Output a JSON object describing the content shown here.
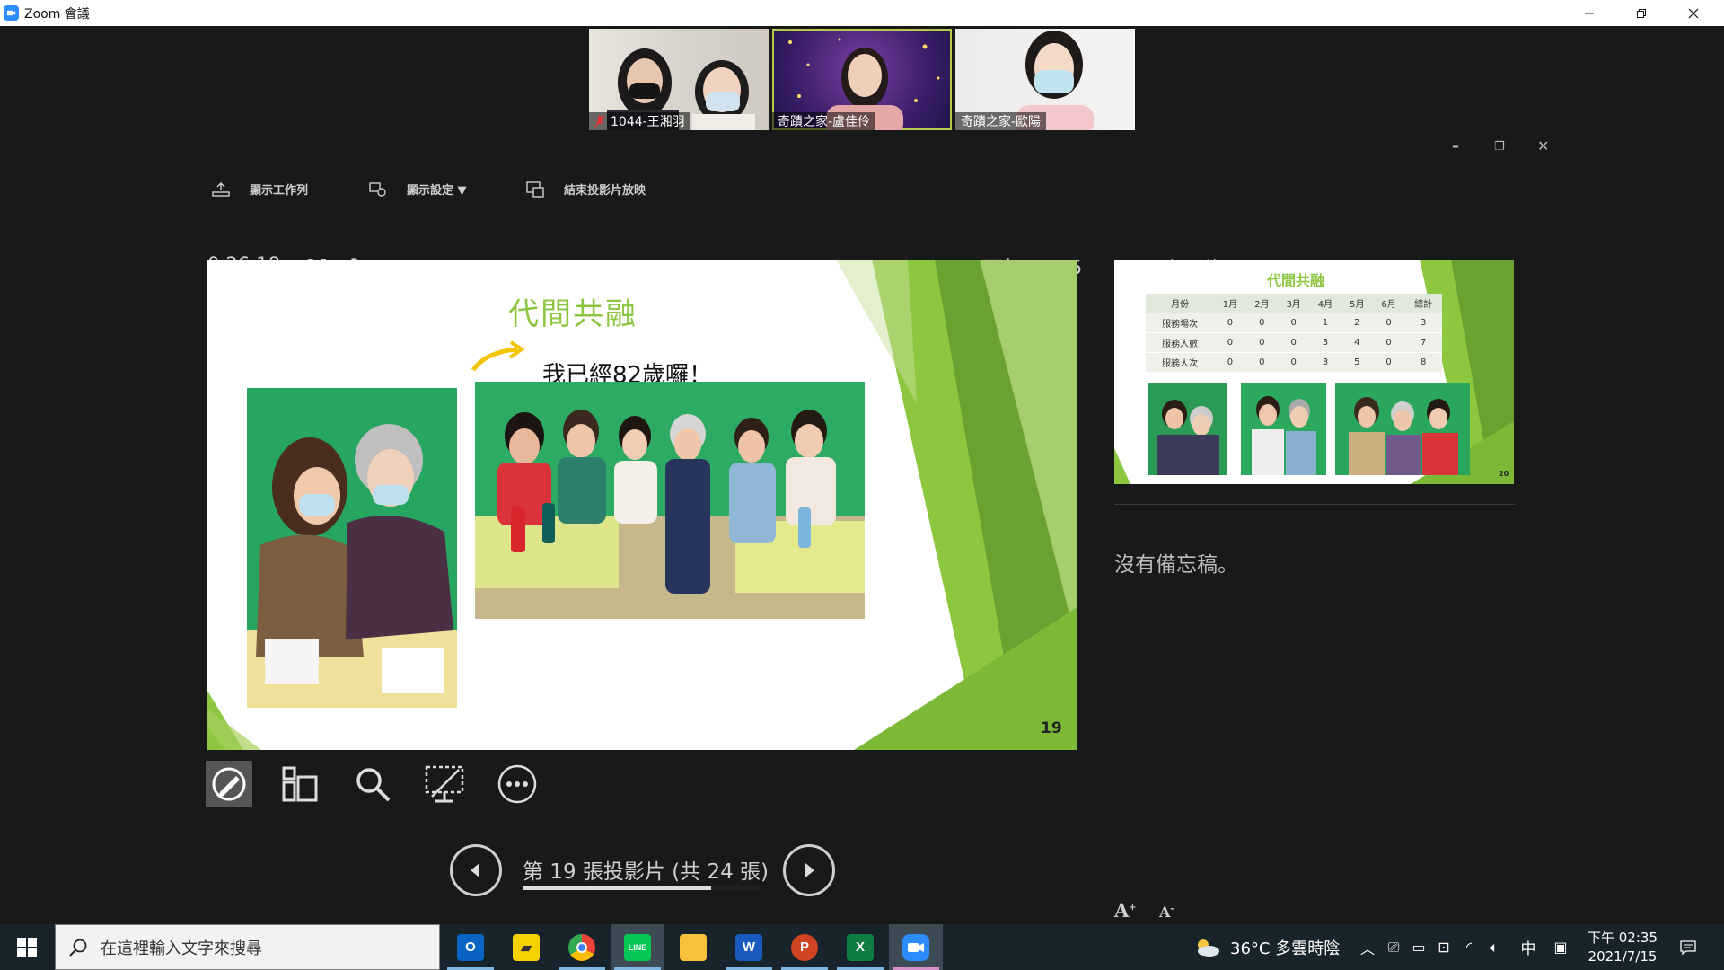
{
  "window": {
    "title": "Zoom 會議"
  },
  "participants": [
    {
      "name": "1044-王湘羽",
      "muted": true
    },
    {
      "name": "奇蹟之家-盧佳伶",
      "active": true
    },
    {
      "name": "奇蹟之家-歐陽"
    }
  ],
  "presenter_toolbar": {
    "show_taskbar": "顯示工作列",
    "display_settings": "顯示設定 ▼",
    "end_show": "結束投影片放映"
  },
  "timer": "0:26:18",
  "clock": "下午 02:35",
  "next_slide_label": "下一張投影片",
  "current_slide": {
    "title": "代間共融",
    "callout": "我已經82歲囉！",
    "number": "19"
  },
  "next_slide": {
    "title": "代間共融",
    "number": "20",
    "table": {
      "headers": [
        "月份",
        "1月",
        "2月",
        "3月",
        "4月",
        "5月",
        "6月",
        "總計"
      ],
      "rows": [
        [
          "服務場次",
          "0",
          "0",
          "0",
          "1",
          "2",
          "0",
          "3"
        ],
        [
          "服務人數",
          "0",
          "0",
          "0",
          "3",
          "4",
          "0",
          "7"
        ],
        [
          "服務人次",
          "0",
          "0",
          "0",
          "3",
          "5",
          "0",
          "8"
        ]
      ]
    }
  },
  "notes": "沒有備忘稿。",
  "navigator": {
    "counter": "第 19 張投影片 (共 24 張)",
    "progress": 0.79
  },
  "taskbar": {
    "search_placeholder": "在這裡輸入文字來搜尋",
    "weather": "36°C 多雲時陰",
    "ime": "中",
    "time": "下午 02:35",
    "date": "2021/7/15",
    "apps": [
      "outlook",
      "sticky-notes",
      "chrome",
      "line",
      "file-explorer",
      "word",
      "powerpoint",
      "excel",
      "zoom"
    ]
  },
  "colors": {
    "slide_green": "#8dc63f",
    "slide_title": "#8cc540",
    "zoom_blue": "#2d8cff"
  }
}
